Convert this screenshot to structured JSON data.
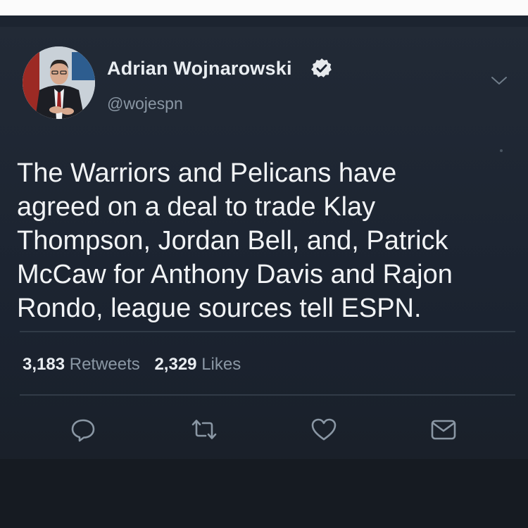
{
  "author": {
    "display_name": "Adrian Wojnarowski",
    "handle": "@wojespn",
    "verified": true
  },
  "tweet": {
    "text": "The Warriors and Pelicans have\nagreed on a deal to trade Klay\nThompson, Jordan Bell, and, Patrick\nMcCaw for Anthony Davis and Rajon\nRondo, league sources tell ESPN."
  },
  "stats": {
    "retweets_count": "3,183",
    "retweets_label": "Retweets",
    "likes_count": "2,329",
    "likes_label": "Likes"
  },
  "actions": {
    "icons": [
      "reply-icon",
      "retweet-icon",
      "like-icon",
      "message-icon"
    ]
  },
  "colors": {
    "background": "#1b2330",
    "text_primary": "#f1f3f5",
    "text_secondary": "#8a97a4",
    "divider": "#313b47",
    "verified_badge": "#e6e9ec"
  }
}
